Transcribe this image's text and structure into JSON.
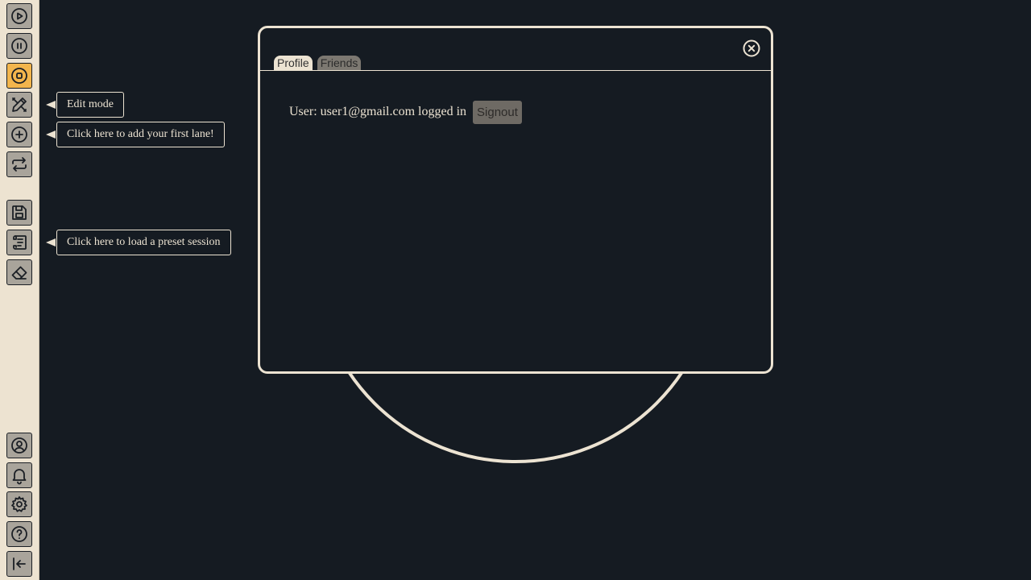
{
  "sidebar": {
    "top_buttons": [
      {
        "icon": "play-icon",
        "active": false
      },
      {
        "icon": "pause-icon",
        "active": false
      },
      {
        "icon": "stop-icon",
        "active": true
      },
      {
        "icon": "edit-mode-icon",
        "active": false
      },
      {
        "icon": "add-lane-icon",
        "active": false
      },
      {
        "icon": "loop-icon",
        "active": false
      },
      {
        "icon": "save-icon",
        "active": false
      },
      {
        "icon": "preset-session-icon",
        "active": false
      },
      {
        "icon": "eraser-icon",
        "active": false
      }
    ],
    "bottom_buttons": [
      {
        "icon": "user-icon"
      },
      {
        "icon": "bell-icon"
      },
      {
        "icon": "gear-icon"
      },
      {
        "icon": "help-icon"
      },
      {
        "icon": "collapse-icon"
      }
    ]
  },
  "tooltips": {
    "edit_mode": "Edit mode",
    "add_lane": "Click here to add your first lane!",
    "load_preset": "Click here to load a preset session"
  },
  "modal": {
    "tabs": [
      {
        "label": "Profile",
        "active": true
      },
      {
        "label": "Friends",
        "active": false
      }
    ],
    "close_icon": "close-circle-icon",
    "user_label": "User:",
    "user_email": "user1@gmail.com",
    "status": "logged in",
    "signout_label": "Signout"
  },
  "colors": {
    "background": "#151b22",
    "sidebar": "#ede3d1",
    "button": "#a9a49b",
    "active_button": "#f3b54c",
    "foreground": "#ece3d2"
  }
}
